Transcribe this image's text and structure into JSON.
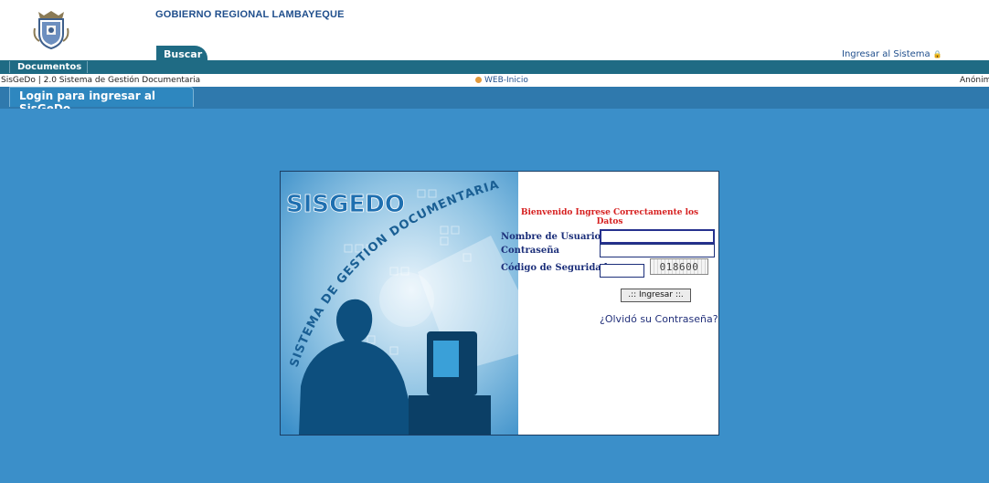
{
  "header": {
    "org_title": "GOBIERNO REGIONAL LAMBAYEQUE",
    "tab_buscar": "Buscar",
    "ingresar_link": "Ingresar al Sistema",
    "logo_icon": "coat-of-arms-icon",
    "lock_icon": "lock-icon"
  },
  "nav": {
    "items": [
      {
        "label": "Documentos"
      }
    ]
  },
  "status": {
    "left": "SisGeDo | 2.0  Sistema de Gestión Documentaria",
    "center": "WEB-Inicio",
    "right": "Anónimo"
  },
  "tabstrip": {
    "active": "Login para ingresar al SisGeDo"
  },
  "login": {
    "art_title": "SISGEDO",
    "art_curve_text": "SISTEMA DE GESTION DOCUMENTARIA",
    "welcome": "Bienvenido Ingrese Correctamente los Datos",
    "username_label": "Nombre de Usuario",
    "username_value": "",
    "password_label": "Contraseña",
    "password_value": "",
    "code_label": "Código de Seguridad",
    "code_value": "",
    "captcha": "018600",
    "submit_label": ".:: Ingresar ::.",
    "forgot": "¿Olvidó su Contraseña?"
  },
  "colors": {
    "nav_bar": "#1f6b84",
    "tab_strip": "#2f79ad",
    "main_bg": "#3b8fc9",
    "welcome_text": "#d62020",
    "label_text": "#1c2f7a"
  }
}
